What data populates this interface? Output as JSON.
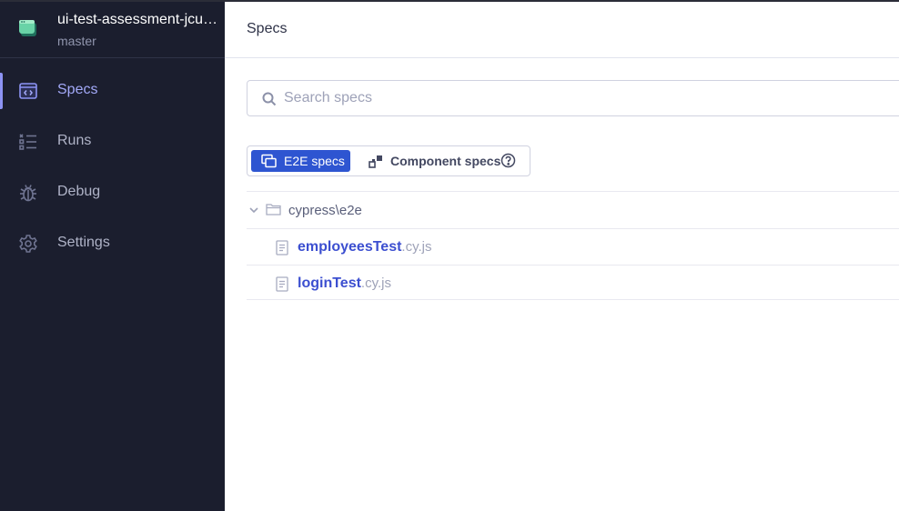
{
  "project": {
    "name": "ui-test-assessment-jcua...",
    "branch": "master",
    "icon": "project-icon"
  },
  "sidebar": {
    "items": [
      {
        "label": "Specs",
        "icon": "specs-icon",
        "active": true
      },
      {
        "label": "Runs",
        "icon": "runs-icon",
        "active": false
      },
      {
        "label": "Debug",
        "icon": "bug-icon",
        "active": false
      },
      {
        "label": "Settings",
        "icon": "gear-icon",
        "active": false
      }
    ]
  },
  "header": {
    "title": "Specs"
  },
  "search": {
    "placeholder": "Search specs",
    "value": ""
  },
  "tabs": {
    "e2e_label": "E2E specs",
    "component_label": "Component specs",
    "selected": "E2E specs"
  },
  "tree": {
    "folder": "cypress\\e2e",
    "specs": [
      {
        "name": "employeesTest",
        "ext": ".cy.js"
      },
      {
        "name": "loginTest",
        "ext": ".cy.js"
      }
    ]
  },
  "colors": {
    "sidebar_bg": "#1b1e2e",
    "accent": "#2e55d1",
    "active_nav": "#a3a9f8",
    "spec_link": "#3c4fd0"
  }
}
